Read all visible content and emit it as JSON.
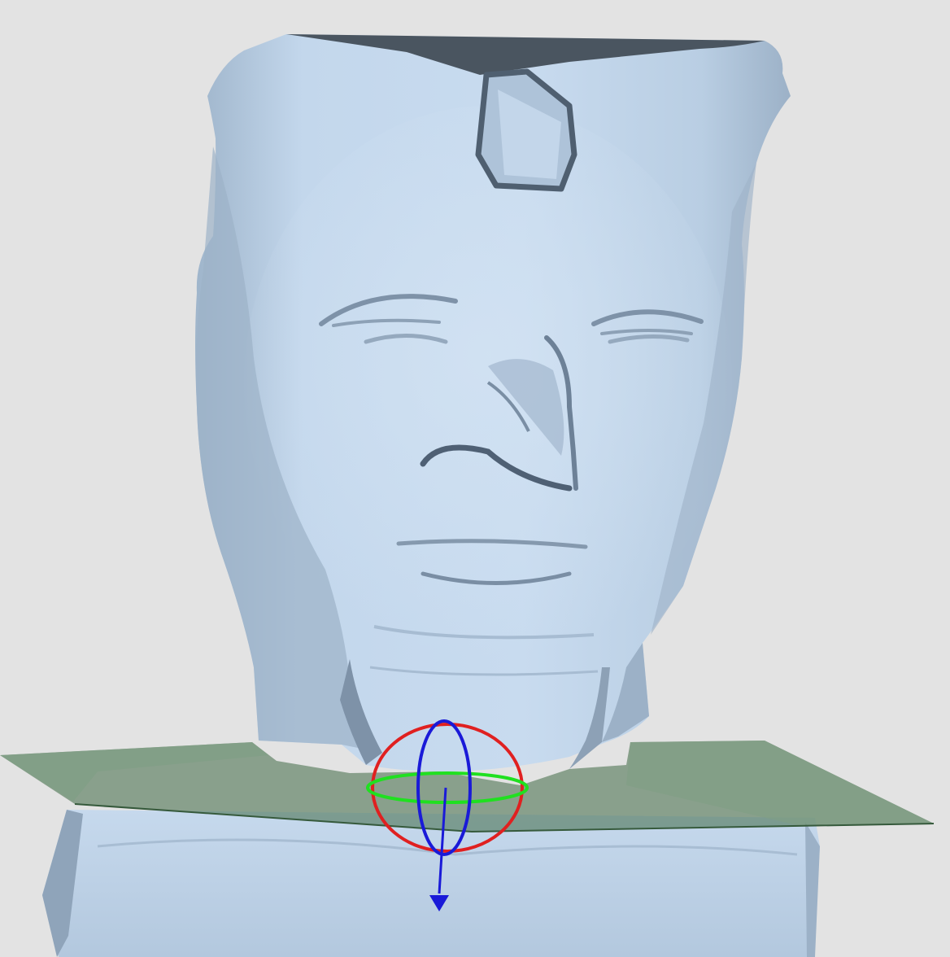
{
  "viewport": {
    "background": "#e3e3e3",
    "mesh_color": "#bcd3ea",
    "mesh_shadow_color": "#7f93a8",
    "mesh_top_cap_color": "#4a5560",
    "cut_plane_color": "#3f6a45",
    "gizmo": {
      "ring_x_color": "#e02020",
      "ring_y_color": "#20e020",
      "ring_z_color": "#1a1ad8",
      "axis_color": "#1a1ad8",
      "arrow_icon": "arrow-down-icon"
    }
  }
}
